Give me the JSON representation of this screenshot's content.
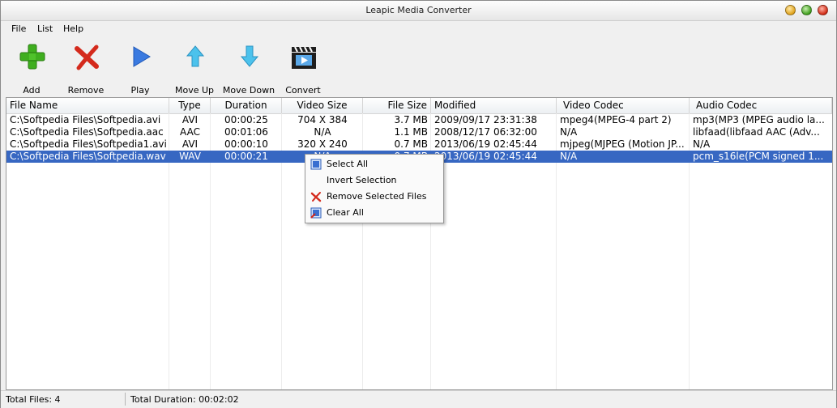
{
  "window": {
    "title": "Leapic Media Converter"
  },
  "menu": [
    "File",
    "List",
    "Help"
  ],
  "toolbar": [
    {
      "label": "Add",
      "icon": "add-icon"
    },
    {
      "label": "Remove",
      "icon": "remove-icon"
    },
    {
      "label": "Play",
      "icon": "play-icon"
    },
    {
      "label": "Move Up",
      "icon": "move-up-icon"
    },
    {
      "label": "Move Down",
      "icon": "move-down-icon"
    },
    {
      "label": "Convert",
      "icon": "clapperboard-icon"
    }
  ],
  "columns": [
    "File Name",
    "Type",
    "Duration",
    "Video Size",
    "File Size",
    "Modified",
    "Video Codec",
    "Audio Codec"
  ],
  "rows": [
    [
      "C:\\Softpedia Files\\Softpedia.avi",
      "AVI",
      "00:00:25",
      "704 X 384",
      "3.7 MB",
      "2009/09/17 23:31:38",
      "mpeg4(MPEG-4 part 2)",
      "mp3(MP3 (MPEG audio la..."
    ],
    [
      "C:\\Softpedia Files\\Softpedia.aac",
      "AAC",
      "00:01:06",
      "N/A",
      "1.1 MB",
      "2008/12/17 06:32:00",
      "N/A",
      "libfaad(libfaad AAC (Adv..."
    ],
    [
      "C:\\Softpedia Files\\Softpedia1.avi",
      "AVI",
      "00:00:10",
      "320 X 240",
      "0.7 MB",
      "2013/06/19 02:45:44",
      "mjpeg(MJPEG (Motion JP...",
      "N/A"
    ],
    [
      "C:\\Softpedia Files\\Softpedia.wav",
      "WAV",
      "00:00:21",
      "N/A",
      "0.7 MB",
      "2013/06/19 02:45:44",
      "N/A",
      "pcm_s16le(PCM signed 1..."
    ]
  ],
  "selected_row": 3,
  "context_menu": [
    {
      "label": "Select All",
      "icon": "select-all-icon"
    },
    {
      "label": "Invert Selection",
      "icon": ""
    },
    {
      "label": "Remove Selected Files",
      "icon": "remove-icon"
    },
    {
      "label": "Clear All",
      "icon": "clear-all-icon"
    }
  ],
  "status": {
    "total_files": "Total Files: 4",
    "total_duration": "Total Duration: 00:02:02"
  },
  "colors": {
    "selection": "#3767c2",
    "add_green": "#3fae1f",
    "remove_red": "#d42a1c",
    "play_blue": "#3a7ae0",
    "arrow_cyan": "#4cc2ec"
  }
}
